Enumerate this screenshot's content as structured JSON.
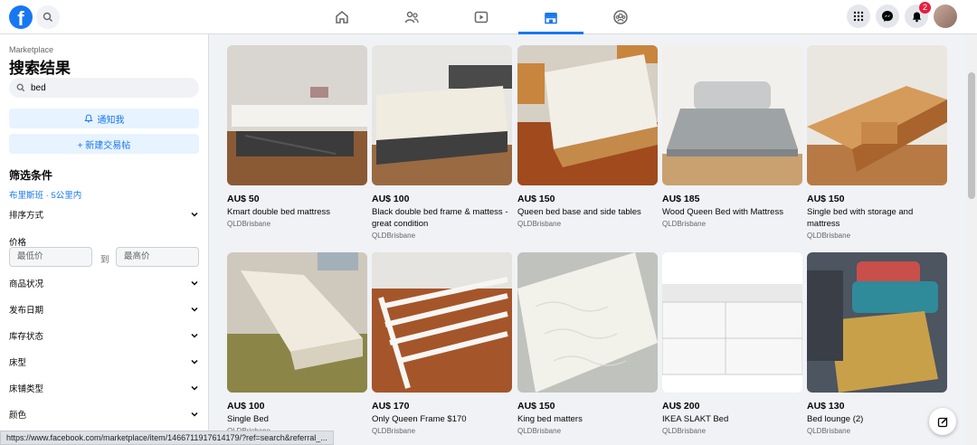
{
  "nav": {
    "logo": "f",
    "tabs": [
      {
        "name": "home-icon",
        "active": false
      },
      {
        "name": "friends-icon",
        "active": false
      },
      {
        "name": "watch-icon",
        "active": false
      },
      {
        "name": "marketplace-icon",
        "active": true
      },
      {
        "name": "groups-icon",
        "active": false
      }
    ],
    "notification_count": "2",
    "accent_color": "#1877f2"
  },
  "sidebar": {
    "section_label": "Marketplace",
    "title": "搜索结果",
    "search_value": "bed",
    "notify_label": "通知我",
    "create_label": "+ 新建交易帖",
    "filters_title": "筛选条件",
    "location": "布里斯班 · 5公里内",
    "sort_label": "排序方式",
    "price_label": "价格",
    "min_placeholder": "最低价",
    "to_label": "到",
    "max_placeholder": "最高价",
    "filters": [
      "商品状况",
      "发布日期",
      "库存状态",
      "床型",
      "床铺类型",
      "颜色"
    ]
  },
  "listings": [
    {
      "price": "AU$ 50",
      "title": "Kmart double bed mattress",
      "location": "QLDBrisbane"
    },
    {
      "price": "AU$ 100",
      "title": "Black double bed frame & mattess - great condition",
      "location": "QLDBrisbane"
    },
    {
      "price": "AU$ 150",
      "title": "Queen bed base and side tables",
      "location": "QLDBrisbane"
    },
    {
      "price": "AU$ 185",
      "title": "Wood Queen Bed with Mattress",
      "location": "QLDBrisbane"
    },
    {
      "price": "AU$ 150",
      "title": "Single bed with storage and mattress",
      "location": "QLDBrisbane"
    },
    {
      "price": "AU$ 100",
      "title": "Single Bed",
      "location": "QLDBrisbane"
    },
    {
      "price": "AU$ 170",
      "title": "Only Queen Frame $170",
      "location": "QLDBrisbane"
    },
    {
      "price": "AU$ 150",
      "title": "King bed matters",
      "location": "QLDBrisbane"
    },
    {
      "price": "AU$ 200",
      "title": "IKEA SLAKT Bed",
      "location": "QLDBrisbane"
    },
    {
      "price": "AU$ 130",
      "title": "Bed lounge (2)",
      "location": "QLDBrisbane"
    }
  ],
  "status_url": "https://www.facebook.com/marketplace/item/1466711917614179/?ref=search&referral_..."
}
